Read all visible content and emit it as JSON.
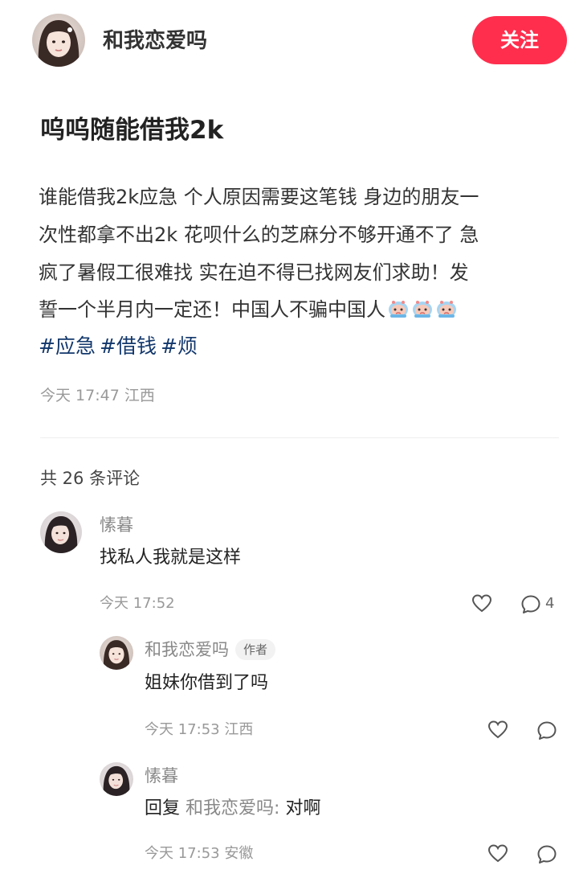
{
  "header": {
    "username": "和我恋爱吗",
    "follow_label": "关注"
  },
  "post": {
    "title": "呜呜随能借我2k",
    "body_lines": [
      "谁能借我2k应急 个人原因需要这笔钱 身边的朋友一",
      "次性都拿不出2k 花呗什么的芝麻分不够开通不了 急",
      "疯了暑假工很难找 实在迫不得已找网友们求助！发",
      "誓一个半月内一定还！中国人不骗中国人"
    ],
    "emoji_icons": [
      "crying-emoji",
      "crying-emoji",
      "crying-emoji"
    ],
    "tags": [
      "#应急",
      "#借钱",
      "#烦"
    ],
    "meta": "今天 17:47 江西"
  },
  "comments": {
    "count_label": "共 26 条评论",
    "items": [
      {
        "name": "愫暮",
        "text": "找私人我就是这样",
        "meta": "今天 17:52",
        "reply_count": "4"
      }
    ],
    "replies": [
      {
        "name": "和我恋爱吗",
        "badge": "作者",
        "text": "姐妹你借到了吗",
        "meta": "今天 17:53 江西"
      },
      {
        "name": "愫暮",
        "reply_prefix": "回复",
        "reply_target": "和我恋爱吗:",
        "text": "对啊",
        "meta": "今天 17:53 安徽"
      }
    ]
  },
  "colors": {
    "follow_button": "#ff2e4d",
    "tag": "#13386c",
    "meta": "#999999"
  }
}
